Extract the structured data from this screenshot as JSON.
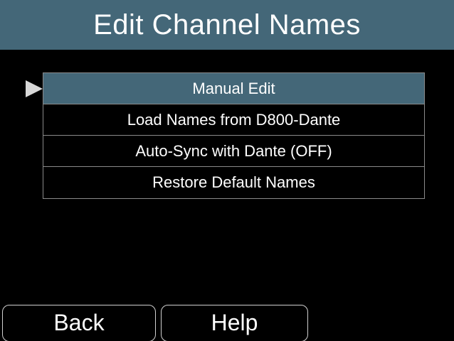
{
  "header": {
    "title": "Edit Channel Names"
  },
  "menu": {
    "selected_index": 0,
    "items": [
      {
        "label": "Manual Edit"
      },
      {
        "label": "Load Names from D800-Dante"
      },
      {
        "label": "Auto-Sync with Dante (OFF)"
      },
      {
        "label": "Restore Default Names"
      }
    ]
  },
  "soft_buttons": {
    "back_label": "Back",
    "help_label": "Help"
  },
  "colors": {
    "header_bg": "#446778",
    "selected_bg": "#446778",
    "background": "#000000",
    "text": "#ffffff",
    "pointer": "#d8d8d8"
  },
  "icons": {
    "pointer": "triangle-pointer-icon"
  }
}
